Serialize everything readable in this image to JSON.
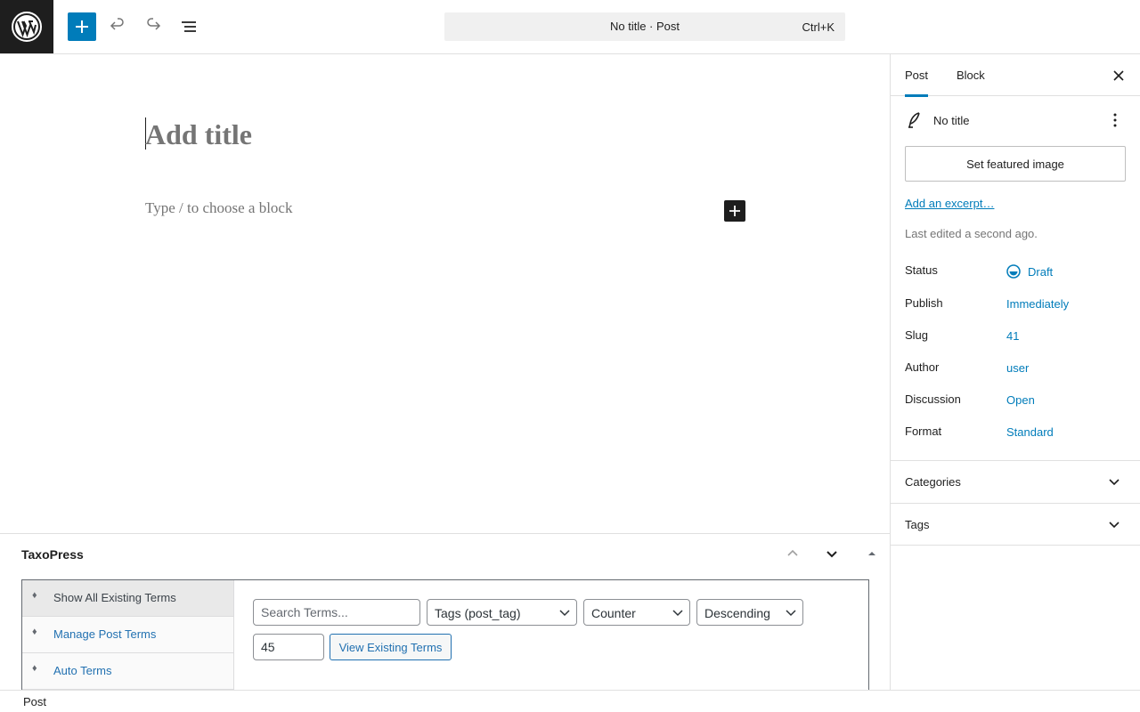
{
  "header": {
    "command_title": "No title · Post",
    "command_shortcut": "Ctrl+K"
  },
  "icons": {
    "logo": "wordpress-logo-icon",
    "add": "plus-icon",
    "undo": "undo-icon",
    "redo": "redo-icon",
    "list_view": "list-view-icon"
  },
  "editor": {
    "title_placeholder": "Add title",
    "block_placeholder": "Type / to choose a block"
  },
  "metabox": {
    "title": "TaxoPress",
    "side_items": [
      {
        "label": "Show All Existing Terms"
      },
      {
        "label": "Manage Post Terms"
      },
      {
        "label": "Auto Terms"
      }
    ],
    "search_placeholder": "Search Terms...",
    "taxonomy_select": "Tags (post_tag)",
    "order_by_select": "Counter",
    "order_select": "Descending",
    "limit_value": "45",
    "view_button": "View Existing Terms"
  },
  "sidebar": {
    "tabs": [
      "Post",
      "Block"
    ],
    "post_title": "No title",
    "featured_image_button": "Set featured image",
    "excerpt_link": "Add an excerpt…",
    "last_edited": "Last edited a second ago.",
    "rows": [
      {
        "label": "Status",
        "value": "Draft"
      },
      {
        "label": "Publish",
        "value": "Immediately"
      },
      {
        "label": "Slug",
        "value": "41"
      },
      {
        "label": "Author",
        "value": "user"
      },
      {
        "label": "Discussion",
        "value": "Open"
      },
      {
        "label": "Format",
        "value": "Standard"
      }
    ],
    "panels": [
      "Categories",
      "Tags"
    ]
  },
  "footer": {
    "breadcrumb": "Post"
  },
  "colors": {
    "accent": "#007cba",
    "dark": "#1e1e1e",
    "link": "#2271b1"
  }
}
